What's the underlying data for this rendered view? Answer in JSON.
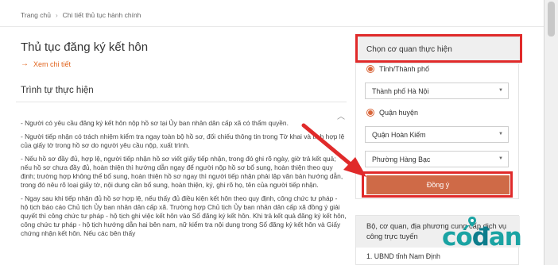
{
  "breadcrumb": {
    "home": "Trang chủ",
    "current": "Chi tiết thủ tục hành chính"
  },
  "main": {
    "title": "Thủ tục đăng ký kết hôn",
    "see_detail": "Xem chi tiết",
    "section_title": "Trình tự thực hiện",
    "paragraphs": [
      "- Người có yêu cầu đăng ký kết hôn nộp hồ sơ tại Ủy ban nhân dân cấp xã có thẩm quyền.",
      "- Người tiếp nhận có trách nhiệm kiểm tra ngay toàn bộ hồ sơ, đối chiếu thông tin trong Tờ khai và tính hợp lệ của giấy tờ trong hồ sơ do người yêu cầu nộp, xuất trình.",
      "- Nếu hồ sơ đầy đủ, hợp lệ, người tiếp nhận hồ sơ viết giấy tiếp nhận, trong đó ghi rõ ngày, giờ trả kết quả; nếu hồ sơ chưa đầy đủ, hoàn thiện thì hướng dẫn ngay để người nộp hồ sơ bổ sung, hoàn thiện theo quy định; trường hợp không thể bổ sung, hoàn thiện hồ sơ ngay thì người tiếp nhận phải lập văn bản hướng dẫn, trong đó nêu rõ loại giấy tờ, nội dung cần bổ sung, hoàn thiện, ký, ghi rõ họ, tên của người tiếp nhận.",
      "- Ngay sau khi tiếp nhận đủ hồ sơ hợp lệ, nếu thấy đủ điều kiện kết hôn theo quy định, công chức tư pháp - hộ tịch báo cáo Chủ tịch Ủy ban nhân dân cấp xã. Trường hợp Chủ tịch Ủy ban nhân dân cấp xã đồng ý giải quyết thì công chức tư pháp - hộ tịch ghi việc kết hôn vào Sổ đăng ký kết hôn. Khi trả kết quả đăng ký kết hôn, công chức tư pháp - hộ tịch hướng dẫn hai bên nam, nữ kiểm tra nội dung trong Sổ đăng ký kết hôn và Giấy chứng nhận kết hôn. Nếu các bên thấy"
    ]
  },
  "agency_panel": {
    "title": "Chọn cơ quan thực hiện",
    "province_label": "Tỉnh/Thành phố",
    "province_value": "Thành phố Hà Nội",
    "district_label": "Quận huyện",
    "district_value": "Quận Hoàn Kiếm",
    "ward_value": "Phường Hàng Bạc",
    "confirm_label": "Đồng ý"
  },
  "providers_panel": {
    "title": "Bộ, cơ quan, địa phương cung cấp dịch vụ công trực tuyến",
    "first_item": "1. UBND tỉnh Nam Định"
  },
  "watermark": {
    "text_a": "có",
    "text_b": "đ",
    "text_c": "an"
  },
  "colors": {
    "accent": "#cf6a47",
    "highlight": "#e02a2a",
    "link": "#e1651f",
    "brand": "#1aa3a3"
  }
}
